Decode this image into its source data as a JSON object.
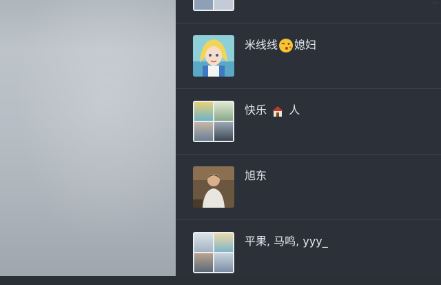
{
  "window": {
    "corner_label": "⋯"
  },
  "chats": [
    {
      "id": "top-partial",
      "name": ""
    },
    {
      "id": "mixianxian",
      "name_parts": [
        "米线线",
        "媳妇"
      ],
      "emoji": "kiss-face"
    },
    {
      "id": "kuaile",
      "name_parts": [
        "快乐",
        "人"
      ],
      "emoji": "house"
    },
    {
      "id": "xudong",
      "name": "旭东"
    },
    {
      "id": "pingguo",
      "name": "平果, 马鸣, yyy_"
    }
  ],
  "colors": {
    "list_bg": "#2c3139",
    "divider": "#3c424b",
    "name_text": "#e4e7eb"
  }
}
